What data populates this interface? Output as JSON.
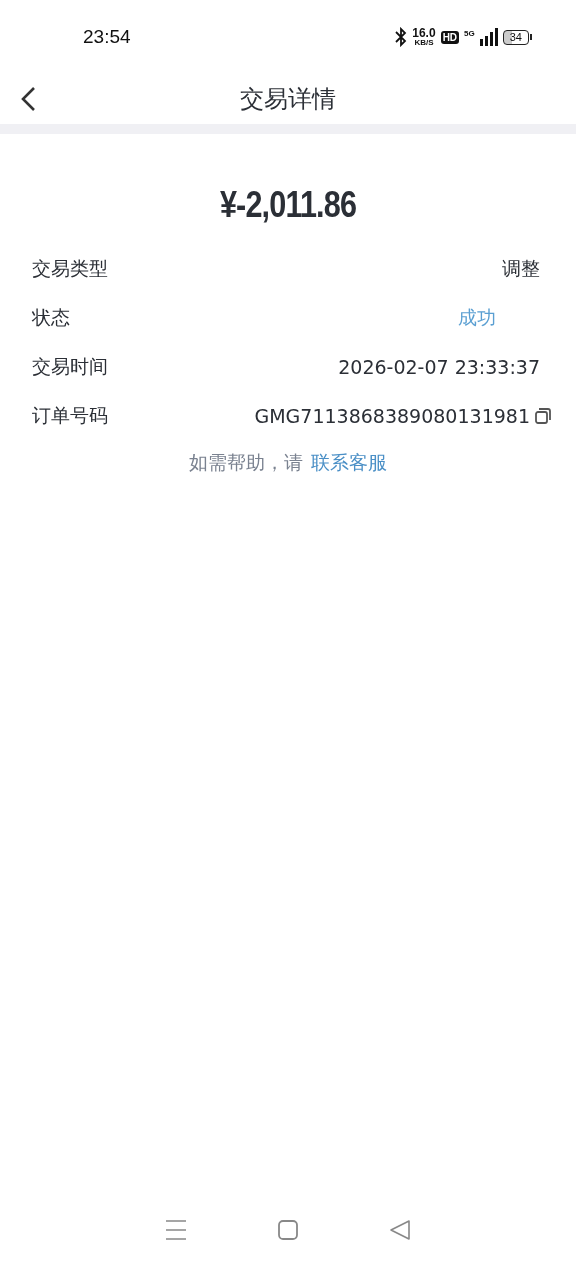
{
  "status_bar": {
    "time": "23:54",
    "speed": "16.0",
    "speed_unit": "KB/S",
    "hd": "HD",
    "network": "5G",
    "battery": "34"
  },
  "header": {
    "title": "交易详情"
  },
  "amount": "¥-2,011.86",
  "details": [
    {
      "label": "交易类型",
      "value": "调整",
      "kind": "plain"
    },
    {
      "label": "状态",
      "value": "成功",
      "kind": "status"
    },
    {
      "label": "交易时间",
      "value": "2026-02-07 23:33:37",
      "kind": "plain"
    },
    {
      "label": "订单号码",
      "value": "GMG7113868389080131981",
      "kind": "copy"
    }
  ],
  "help": {
    "text": "如需帮助，请",
    "link": "联系客服"
  }
}
